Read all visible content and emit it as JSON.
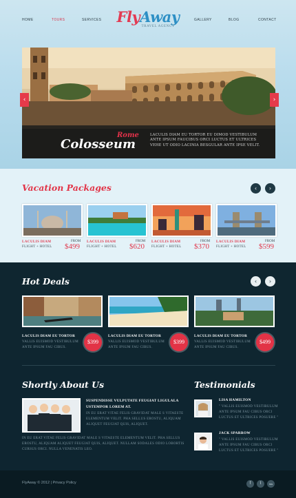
{
  "brand": {
    "logo_part1": "Fly",
    "logo_part2": "Away",
    "tagline": "TRAVEL AGENCY"
  },
  "nav": {
    "items": [
      "HOME",
      "TOURS",
      "SERVICES",
      "GALLERY",
      "BLOG",
      "CONTACT"
    ],
    "active": "TOURS"
  },
  "slider": {
    "city": "Rome",
    "place": "Colosseum",
    "description": "LACULIS DIAM EU TORTOR EU DIMOD VESTIBULUM ANTE IPSUM FAUCIBUS ORCI LUCTUS ET ULTRICES VEHE UT ODIO LACINIA BESGULAR ANTE IPSE VELIT.",
    "prev_icon": "chevron-left-icon",
    "next_icon": "chevron-right-icon"
  },
  "vacation": {
    "title": "Vacation Packages",
    "packages": [
      {
        "label": "LACULIS DIAM",
        "sub": "FLIGHT + HOTEL",
        "from": "FROM",
        "price": "$499"
      },
      {
        "label": "LACULIS DIAM",
        "sub": "FLIGHT + HOTEL",
        "from": "FROM",
        "price": "$620"
      },
      {
        "label": "LACULIS DIAM",
        "sub": "FLIGHT + HOTEL",
        "from": "FROM",
        "price": "$370"
      },
      {
        "label": "LACULIS DIAM",
        "sub": "FLIGHT + HOTEL",
        "from": "FROM",
        "price": "$599"
      }
    ]
  },
  "hot_deals": {
    "title": "Hot Deals",
    "deals": [
      {
        "title": "LACULIS DIAM EU TORTOR",
        "desc": "VALLIS EUISMOD VESTIBULUM ANTE IPSUM FAU CIBUS.",
        "price": "$399"
      },
      {
        "title": "LACULIS DIAM EU TORTOR",
        "desc": "VALLIS EUISMOD VESTIBULUM ANTE IPSUM FAU CIBUS.",
        "price": "$399"
      },
      {
        "title": "LACULIS DIAM EU TORTOR",
        "desc": "VALLIS EUISMOD VESTIBULUM ANTE IPSUM FAU CIBUS.",
        "price": "$499"
      }
    ]
  },
  "about": {
    "title": "Shortly About Us",
    "heading": "SUSPENDISSE VULPUTATE FEUGIAT LIGULALA USTEMPOR LOREM AT.",
    "text1": "IN EU ERAT VITAE FELIS GRAVIDAT MALE S VITAESTE ELEMENTUM VELIT. PHA SELLUS EROSTU, ALIQUAM ALIQUET FEUGIAT QUIS, ALIQUET.",
    "text2": "IN EU ERAT VITAE FELIS GRAVIDAT MALE S VITAESTE ELEMENTUM VELIT. PHA SELLUS EROSTU, ALIQUAM ALIQUET FEUGIAT QUIS, ALIQUET. NULLAM SODALES ODIO LOBORTIS CURSUS ORCI. NULLA VENENATIS LEO."
  },
  "testimonials": {
    "title": "Testimonials",
    "items": [
      {
        "name": "LISA HAMILTON",
        "quote": "\" VALLIS EUISMOD VESTIBULUM ANTE IPSUM FAU CIBUS ORCI LUCTUS ET ULTRICES POSUERE \""
      },
      {
        "name": "JACK SPARROW",
        "quote": "\" VALLIS EUISMOD VESTIBULUM ANTE IPSUM FAU CIBUS ORCI LUCTUS ET ULTRICES POSUERE \""
      }
    ]
  },
  "footer": {
    "text": "FlyAway © 2012 | Privacy Policy",
    "social": [
      "f",
      "t",
      "rss"
    ]
  },
  "colors": {
    "accent": "#e33a52",
    "blue": "#2d8fc5",
    "dark": "#0f2630"
  }
}
